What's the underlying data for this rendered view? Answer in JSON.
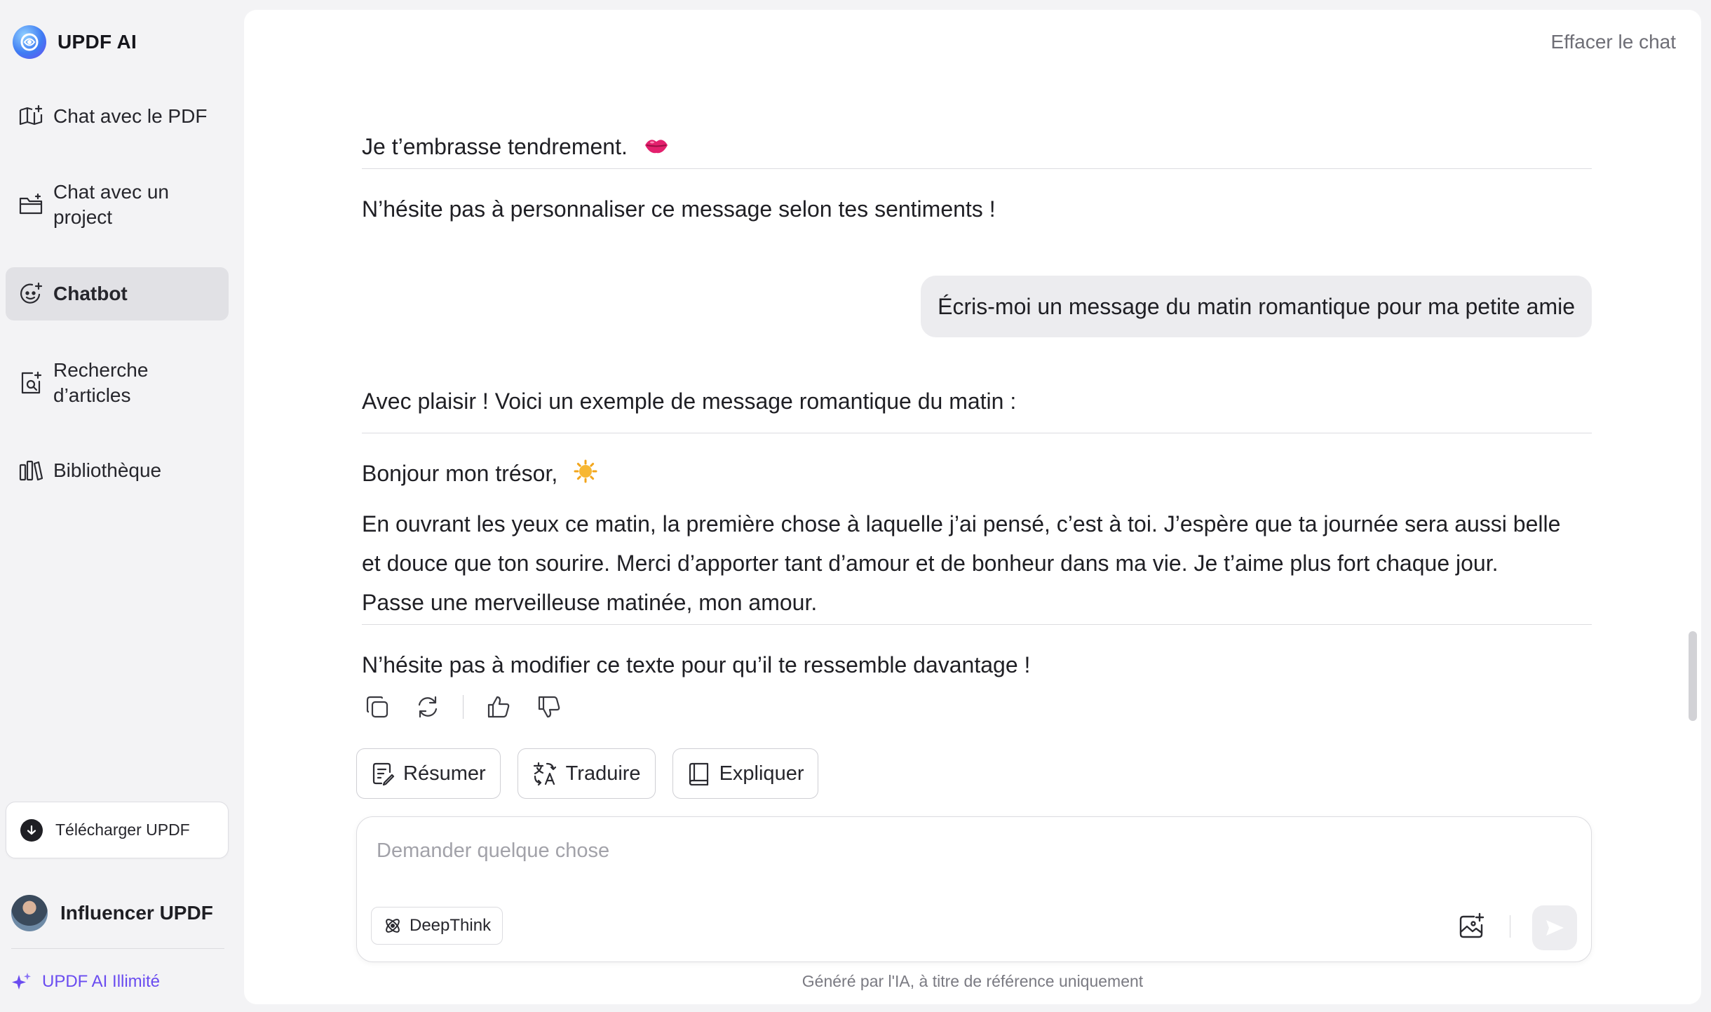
{
  "brand": {
    "name": "UPDF AI"
  },
  "sidebar": {
    "items": [
      {
        "label": "Chat avec le PDF",
        "icon": "book-sparkle-icon"
      },
      {
        "label": "Chat avec un project",
        "icon": "folder-icon"
      },
      {
        "label": "Chatbot",
        "icon": "chatbot-face-icon",
        "active": true
      },
      {
        "label": "Recherche d’articles",
        "icon": "document-search-icon"
      },
      {
        "label": "Bibliothèque",
        "icon": "library-icon"
      }
    ],
    "download_label": "Télécharger UPDF",
    "user_name": "Influencer UPDF",
    "plan_label": "UPDF AI Illimité"
  },
  "header": {
    "clear_chat": "Effacer le chat"
  },
  "messages": {
    "prev_line1": "Je t’embrasse tendrement.",
    "prev_line2": "N’hésite pas à personnaliser ce message selon tes sentiments !",
    "user_prompt": "Écris-moi un message du matin romantique pour ma petite amie",
    "answer_intro": "Avec plaisir ! Voici un exemple de message romantique du matin :",
    "answer_greeting": "Bonjour mon trésor,",
    "answer_body_1": "En ouvrant les yeux ce matin, la première chose à laquelle j’ai pensé, c’est à toi. J’espère que ta journée sera aussi belle",
    "answer_body_2": "et douce que ton sourire. Merci d’apporter tant d’amour et de bonheur dans ma vie. Je t’aime plus fort chaque jour.",
    "answer_body_3": "Passe une merveilleuse matinée, mon amour.",
    "answer_outro": "N’hésite pas à modifier ce texte pour qu’il te ressemble davantage !"
  },
  "quick_actions": [
    {
      "label": "Résumer",
      "icon": "summary-icon"
    },
    {
      "label": "Traduire",
      "icon": "translate-icon"
    },
    {
      "label": "Expliquer",
      "icon": "book-icon"
    }
  ],
  "composer": {
    "placeholder": "Demander quelque chose",
    "value": "",
    "deepthink_label": "DeepThink"
  },
  "footer": {
    "disclaimer": "Généré par l'IA, à titre de référence uniquement"
  }
}
